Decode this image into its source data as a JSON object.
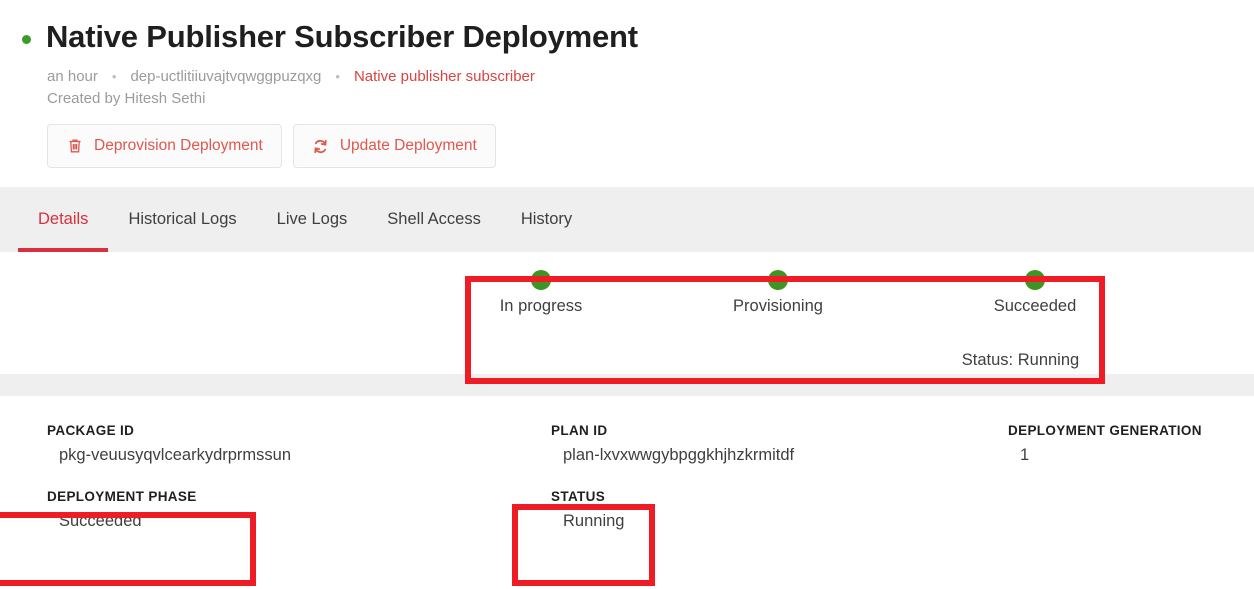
{
  "header": {
    "status_dot_color": "#3a9b28",
    "title": "Native Publisher Subscriber Deployment",
    "meta": {
      "time": "an hour",
      "separator": "•",
      "deployment_id": "dep-uctlitiiuvajtvqwggpuzqxg",
      "package_link": "Native publisher subscriber"
    },
    "created_by": "Created by Hitesh Sethi"
  },
  "actions": {
    "deprovision": {
      "label": "Deprovision Deployment",
      "icon": "trash-icon"
    },
    "update": {
      "label": "Update Deployment",
      "icon": "refresh-icon"
    },
    "accent_color": "#e0574f"
  },
  "tabs": [
    {
      "label": "Details",
      "active": true
    },
    {
      "label": "Historical Logs",
      "active": false
    },
    {
      "label": "Live Logs",
      "active": false
    },
    {
      "label": "Shell Access",
      "active": false
    },
    {
      "label": "History",
      "active": false
    }
  ],
  "tabs_accent_color": "#d8303e",
  "stepper": {
    "color": "#3f9523",
    "steps": [
      {
        "label": "In progress",
        "complete": true
      },
      {
        "label": "Provisioning",
        "complete": true
      },
      {
        "label": "Succeeded",
        "complete": true
      }
    ],
    "substatus": "Status: Running"
  },
  "details": [
    {
      "label": "PACKAGE ID",
      "value": "pkg-veuusyqvlcearkydrprmssun"
    },
    {
      "label": "PLAN ID",
      "value": "plan-lxvxwwgybpggkhjhzkrmitdf"
    },
    {
      "label": "DEPLOYMENT GENERATION",
      "value": "1"
    },
    {
      "label": "DEPLOYMENT PHASE",
      "value": "Succeeded"
    },
    {
      "label": "STATUS",
      "value": "Running"
    }
  ],
  "annotation_color": "#ef1c25"
}
